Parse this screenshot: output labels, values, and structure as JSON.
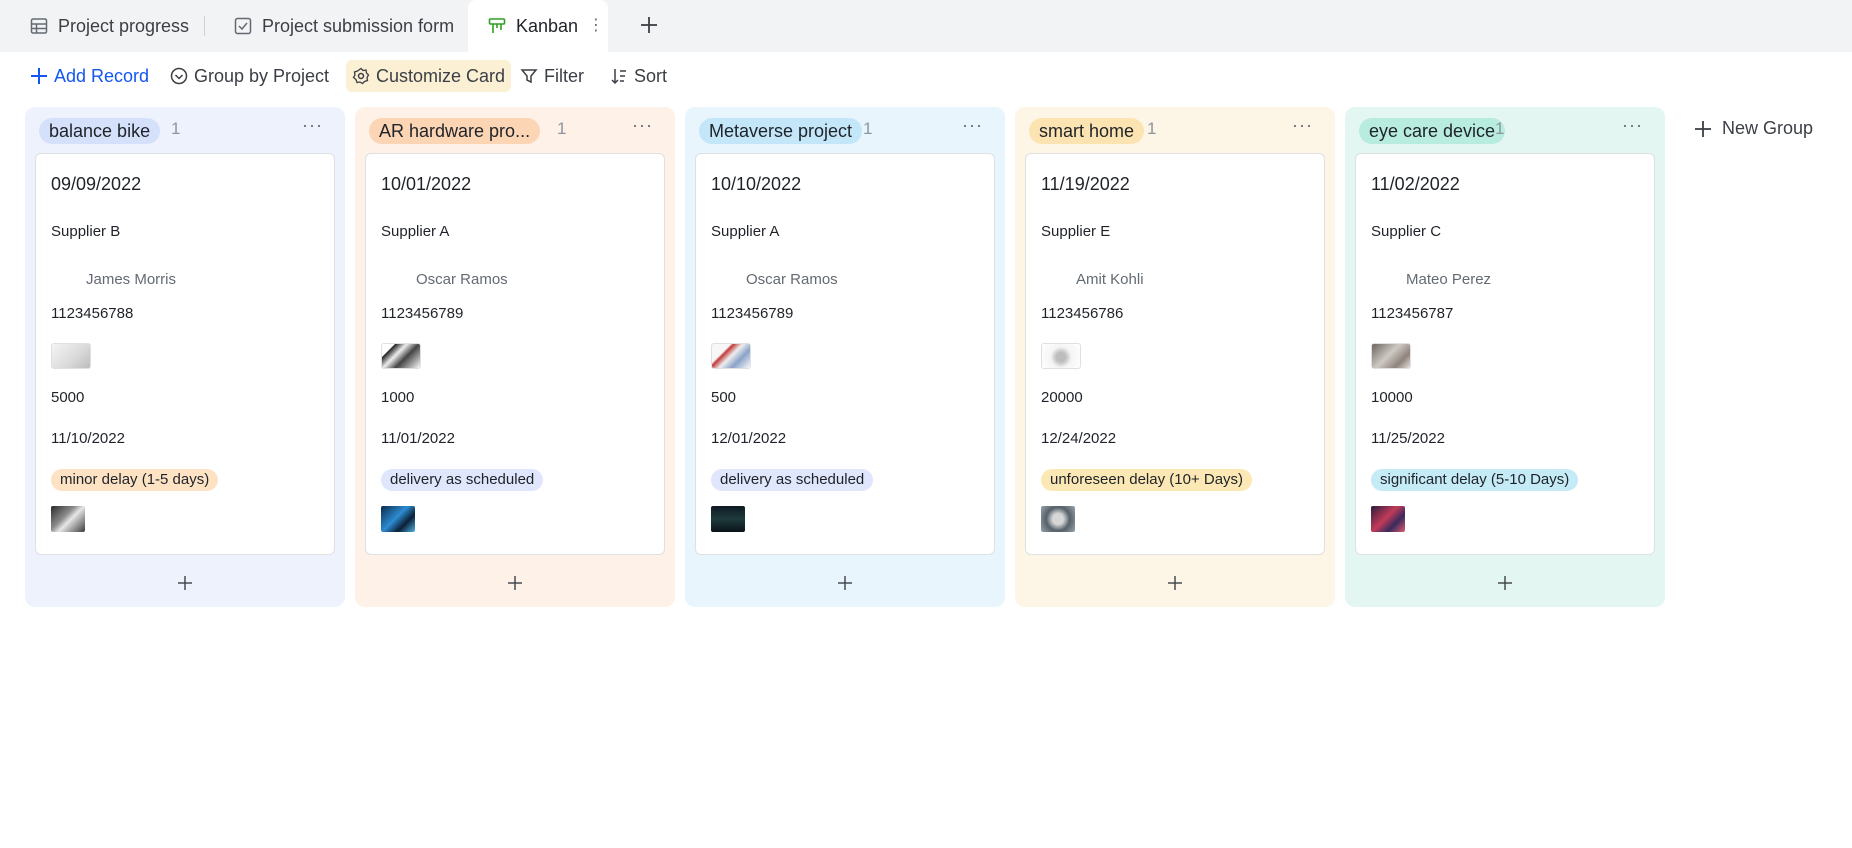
{
  "tabs": [
    {
      "label": "Project progress",
      "icon": "table-icon"
    },
    {
      "label": "Project submission form",
      "icon": "form-icon"
    },
    {
      "label": "Kanban",
      "icon": "kanban-icon",
      "active": true
    }
  ],
  "toolbar": {
    "add_record": "Add Record",
    "group_by": "Group by Project",
    "customize": "Customize Card",
    "filter": "Filter",
    "sort": "Sort"
  },
  "new_group": "New Group",
  "colors": {
    "accent": "#1456f0",
    "kanban_icon": "#2ea121"
  },
  "columns": [
    {
      "name": "balance bike",
      "count": "1",
      "bg": "#eef2fd",
      "chip": "#d5e1fb",
      "card": {
        "date": "09/09/2022",
        "supplier": "Supplier B",
        "person": "James Morris",
        "phone": "1123456788",
        "quantity": "5000",
        "due": "11/10/2022",
        "status": "minor delay (1-5 days)",
        "status_bg": "#fde3c4"
      }
    },
    {
      "name": "AR hardware pro...",
      "count": "1",
      "bg": "#fdf1e8",
      "chip": "#fcd5b5",
      "card": {
        "date": "10/01/2022",
        "supplier": "Supplier A",
        "person": "Oscar Ramos",
        "phone": "1123456789",
        "quantity": "1000",
        "due": "11/01/2022",
        "status": "delivery as scheduled",
        "status_bg": "#e0e6fb"
      }
    },
    {
      "name": "Metaverse project",
      "count": "1",
      "bg": "#e8f5fc",
      "chip": "#c3e6f8",
      "card": {
        "date": "10/10/2022",
        "supplier": "Supplier A",
        "person": "Oscar Ramos",
        "phone": "1123456789",
        "quantity": "500",
        "due": "12/01/2022",
        "status": "delivery as scheduled",
        "status_bg": "#e0e6fb"
      }
    },
    {
      "name": "smart home",
      "count": "1",
      "bg": "#fdf5e6",
      "chip": "#fbe4b2",
      "card": {
        "date": "11/19/2022",
        "supplier": "Supplier E",
        "person": "Amit Kohli",
        "phone": "1123456786",
        "quantity": "20000",
        "due": "12/24/2022",
        "status": "unforeseen delay (10+ Days)",
        "status_bg": "#fbe8b4"
      }
    },
    {
      "name": "eye care device",
      "count": "1",
      "bg": "#e3f6f1",
      "chip": "#b7ecde",
      "card": {
        "date": "11/02/2022",
        "supplier": "Supplier C",
        "person": "Mateo Perez",
        "phone": "1123456787",
        "quantity": "10000",
        "due": "11/25/2022",
        "status": "significant delay (5-10 Days)",
        "status_bg": "#c4ebf6"
      }
    }
  ]
}
